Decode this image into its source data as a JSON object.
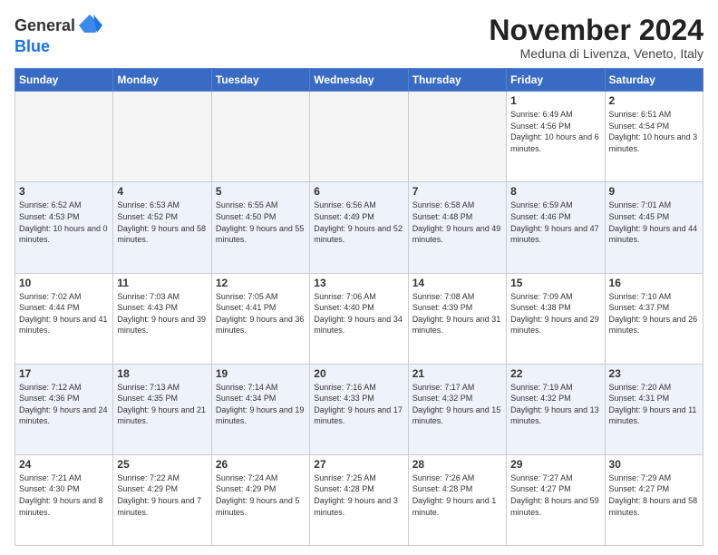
{
  "logo": {
    "general": "General",
    "blue": "Blue"
  },
  "header": {
    "month_title": "November 2024",
    "location": "Meduna di Livenza, Veneto, Italy"
  },
  "days_of_week": [
    "Sunday",
    "Monday",
    "Tuesday",
    "Wednesday",
    "Thursday",
    "Friday",
    "Saturday"
  ],
  "weeks": [
    [
      {
        "day": "",
        "empty": true
      },
      {
        "day": "",
        "empty": true
      },
      {
        "day": "",
        "empty": true
      },
      {
        "day": "",
        "empty": true
      },
      {
        "day": "",
        "empty": true
      },
      {
        "day": "1",
        "sunrise": "Sunrise: 6:49 AM",
        "sunset": "Sunset: 4:56 PM",
        "daylight": "Daylight: 10 hours and 6 minutes."
      },
      {
        "day": "2",
        "sunrise": "Sunrise: 6:51 AM",
        "sunset": "Sunset: 4:54 PM",
        "daylight": "Daylight: 10 hours and 3 minutes."
      }
    ],
    [
      {
        "day": "3",
        "sunrise": "Sunrise: 6:52 AM",
        "sunset": "Sunset: 4:53 PM",
        "daylight": "Daylight: 10 hours and 0 minutes."
      },
      {
        "day": "4",
        "sunrise": "Sunrise: 6:53 AM",
        "sunset": "Sunset: 4:52 PM",
        "daylight": "Daylight: 9 hours and 58 minutes."
      },
      {
        "day": "5",
        "sunrise": "Sunrise: 6:55 AM",
        "sunset": "Sunset: 4:50 PM",
        "daylight": "Daylight: 9 hours and 55 minutes."
      },
      {
        "day": "6",
        "sunrise": "Sunrise: 6:56 AM",
        "sunset": "Sunset: 4:49 PM",
        "daylight": "Daylight: 9 hours and 52 minutes."
      },
      {
        "day": "7",
        "sunrise": "Sunrise: 6:58 AM",
        "sunset": "Sunset: 4:48 PM",
        "daylight": "Daylight: 9 hours and 49 minutes."
      },
      {
        "day": "8",
        "sunrise": "Sunrise: 6:59 AM",
        "sunset": "Sunset: 4:46 PM",
        "daylight": "Daylight: 9 hours and 47 minutes."
      },
      {
        "day": "9",
        "sunrise": "Sunrise: 7:01 AM",
        "sunset": "Sunset: 4:45 PM",
        "daylight": "Daylight: 9 hours and 44 minutes."
      }
    ],
    [
      {
        "day": "10",
        "sunrise": "Sunrise: 7:02 AM",
        "sunset": "Sunset: 4:44 PM",
        "daylight": "Daylight: 9 hours and 41 minutes."
      },
      {
        "day": "11",
        "sunrise": "Sunrise: 7:03 AM",
        "sunset": "Sunset: 4:43 PM",
        "daylight": "Daylight: 9 hours and 39 minutes."
      },
      {
        "day": "12",
        "sunrise": "Sunrise: 7:05 AM",
        "sunset": "Sunset: 4:41 PM",
        "daylight": "Daylight: 9 hours and 36 minutes."
      },
      {
        "day": "13",
        "sunrise": "Sunrise: 7:06 AM",
        "sunset": "Sunset: 4:40 PM",
        "daylight": "Daylight: 9 hours and 34 minutes."
      },
      {
        "day": "14",
        "sunrise": "Sunrise: 7:08 AM",
        "sunset": "Sunset: 4:39 PM",
        "daylight": "Daylight: 9 hours and 31 minutes."
      },
      {
        "day": "15",
        "sunrise": "Sunrise: 7:09 AM",
        "sunset": "Sunset: 4:38 PM",
        "daylight": "Daylight: 9 hours and 29 minutes."
      },
      {
        "day": "16",
        "sunrise": "Sunrise: 7:10 AM",
        "sunset": "Sunset: 4:37 PM",
        "daylight": "Daylight: 9 hours and 26 minutes."
      }
    ],
    [
      {
        "day": "17",
        "sunrise": "Sunrise: 7:12 AM",
        "sunset": "Sunset: 4:36 PM",
        "daylight": "Daylight: 9 hours and 24 minutes."
      },
      {
        "day": "18",
        "sunrise": "Sunrise: 7:13 AM",
        "sunset": "Sunset: 4:35 PM",
        "daylight": "Daylight: 9 hours and 21 minutes."
      },
      {
        "day": "19",
        "sunrise": "Sunrise: 7:14 AM",
        "sunset": "Sunset: 4:34 PM",
        "daylight": "Daylight: 9 hours and 19 minutes."
      },
      {
        "day": "20",
        "sunrise": "Sunrise: 7:16 AM",
        "sunset": "Sunset: 4:33 PM",
        "daylight": "Daylight: 9 hours and 17 minutes."
      },
      {
        "day": "21",
        "sunrise": "Sunrise: 7:17 AM",
        "sunset": "Sunset: 4:32 PM",
        "daylight": "Daylight: 9 hours and 15 minutes."
      },
      {
        "day": "22",
        "sunrise": "Sunrise: 7:19 AM",
        "sunset": "Sunset: 4:32 PM",
        "daylight": "Daylight: 9 hours and 13 minutes."
      },
      {
        "day": "23",
        "sunrise": "Sunrise: 7:20 AM",
        "sunset": "Sunset: 4:31 PM",
        "daylight": "Daylight: 9 hours and 11 minutes."
      }
    ],
    [
      {
        "day": "24",
        "sunrise": "Sunrise: 7:21 AM",
        "sunset": "Sunset: 4:30 PM",
        "daylight": "Daylight: 9 hours and 8 minutes."
      },
      {
        "day": "25",
        "sunrise": "Sunrise: 7:22 AM",
        "sunset": "Sunset: 4:29 PM",
        "daylight": "Daylight: 9 hours and 7 minutes."
      },
      {
        "day": "26",
        "sunrise": "Sunrise: 7:24 AM",
        "sunset": "Sunset: 4:29 PM",
        "daylight": "Daylight: 9 hours and 5 minutes."
      },
      {
        "day": "27",
        "sunrise": "Sunrise: 7:25 AM",
        "sunset": "Sunset: 4:28 PM",
        "daylight": "Daylight: 9 hours and 3 minutes."
      },
      {
        "day": "28",
        "sunrise": "Sunrise: 7:26 AM",
        "sunset": "Sunset: 4:28 PM",
        "daylight": "Daylight: 9 hours and 1 minute."
      },
      {
        "day": "29",
        "sunrise": "Sunrise: 7:27 AM",
        "sunset": "Sunset: 4:27 PM",
        "daylight": "Daylight: 8 hours and 59 minutes."
      },
      {
        "day": "30",
        "sunrise": "Sunrise: 7:29 AM",
        "sunset": "Sunset: 4:27 PM",
        "daylight": "Daylight: 8 hours and 58 minutes."
      }
    ]
  ]
}
